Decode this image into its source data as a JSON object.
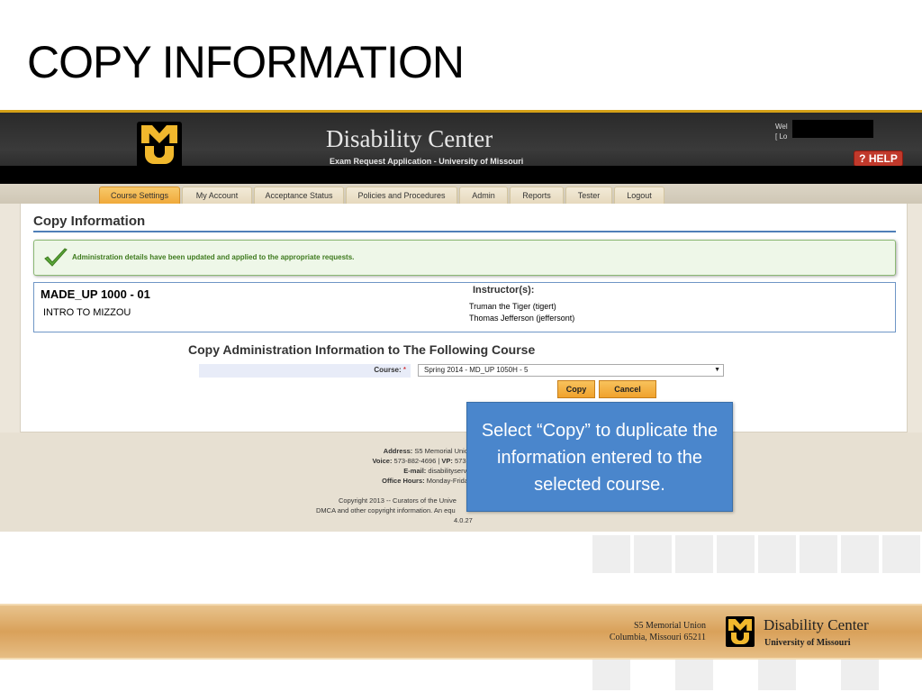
{
  "slide": {
    "title": "COPY INFORMATION"
  },
  "header": {
    "app_title": "Disability Center",
    "subtitle": "Exam Request Application - University of Missouri",
    "welcome": "Wel",
    "logout_link": "[ Lo",
    "help_label": "? HELP"
  },
  "nav": {
    "tabs": [
      {
        "label": "Course Settings",
        "active": true
      },
      {
        "label": "My Account"
      },
      {
        "label": "Acceptance Status"
      },
      {
        "label": "Policies and Procedures"
      },
      {
        "label": "Admin"
      },
      {
        "label": "Reports"
      },
      {
        "label": "Tester"
      },
      {
        "label": "Logout"
      }
    ]
  },
  "main": {
    "heading": "Copy Information",
    "success_message": "Administration details have been updated and applied to the appropriate requests.",
    "course": {
      "code": "MADE_UP 1000 - 01",
      "name": "INTRO TO MIZZOU",
      "instructors_label": "Instructor(s):",
      "instructors": [
        "Truman the Tiger (tigert)",
        "Thomas Jefferson (jeffersont)"
      ]
    },
    "copy_heading": "Copy Administration Information to The Following Course",
    "course_field_label": "Course:",
    "required_mark": "*",
    "course_selected": "Spring 2014 - MD_UP 1050H - 5",
    "copy_button": "Copy",
    "cancel_button": "Cancel"
  },
  "footer": {
    "address_label": "Address:",
    "address_value": "S5 Memorial Unio",
    "voice_label": "Voice:",
    "voice_value": "573-882-4696 |",
    "vp_label": "VP:",
    "vp_value": "573-",
    "email_label": "E-mail:",
    "email_value": "disabilityservi",
    "hours_label": "Office Hours:",
    "hours_value": "Monday-Frida",
    "copyright": "Copyright 2013 -- Curators of the Unive",
    "dmca": "DMCA and other copyright information. An equ",
    "version": "4.0.27"
  },
  "callout": {
    "text": "Select “Copy” to duplicate the information entered to the selected course."
  },
  "branding": {
    "address_line1": "S5 Memorial Union",
    "address_line2": "Columbia, Missouri 65211",
    "name": "Disability Center",
    "university": "University of Missouri"
  },
  "colors": {
    "accent_gold": "#f1b82d",
    "tab_active": "#f0a93a",
    "link_blue": "#4f7fb8",
    "success_green": "#3e7a1e",
    "callout_blue": "#4a86cc"
  }
}
